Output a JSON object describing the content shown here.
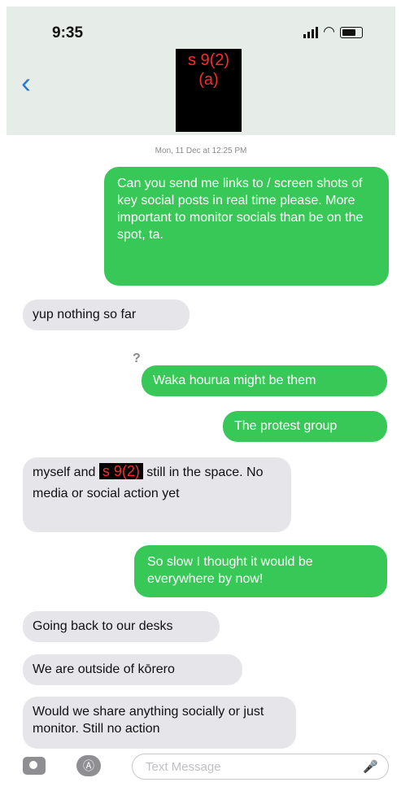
{
  "status_bar": {
    "time": "9:35"
  },
  "header": {
    "back_icon": "chevron-left-icon",
    "title_redaction": "s 9(2)\n(a)"
  },
  "thread": {
    "timestamp": "Mon, 11 Dec at 12:25 PM",
    "messages": [
      {
        "type": "sent",
        "text": "Can you send me links to / screen shots of key social posts in real time please. More important to monitor socials than be on the spot, ta."
      },
      {
        "type": "received",
        "text": "yup nothing so far"
      },
      {
        "type": "received_marker",
        "text": "?"
      },
      {
        "type": "sent",
        "text": "Waka hourua might be them"
      },
      {
        "type": "sent",
        "text": "The protest group"
      },
      {
        "type": "received",
        "text_before": "myself and",
        "redaction": "s 9(2)",
        "text_after": "still in the space. No media or social action yet"
      },
      {
        "type": "sent",
        "text": "So slow I thought it would be everywhere by now!"
      },
      {
        "type": "received",
        "text": "Going back to our desks"
      },
      {
        "type": "received",
        "text": "We are outside of kōrero"
      },
      {
        "type": "received",
        "text": "Would we share anything socially or just monitor. Still no action"
      }
    ]
  },
  "compose": {
    "placeholder": "Text Message",
    "icons": [
      "camera-icon",
      "app-store-icon",
      "microphone-icon"
    ]
  },
  "colors": {
    "sent_bubble": "#38c857",
    "received_bubble": "#e5e5ea",
    "accent": "#2a7ad8",
    "redaction_text": "#ff2a2a"
  }
}
